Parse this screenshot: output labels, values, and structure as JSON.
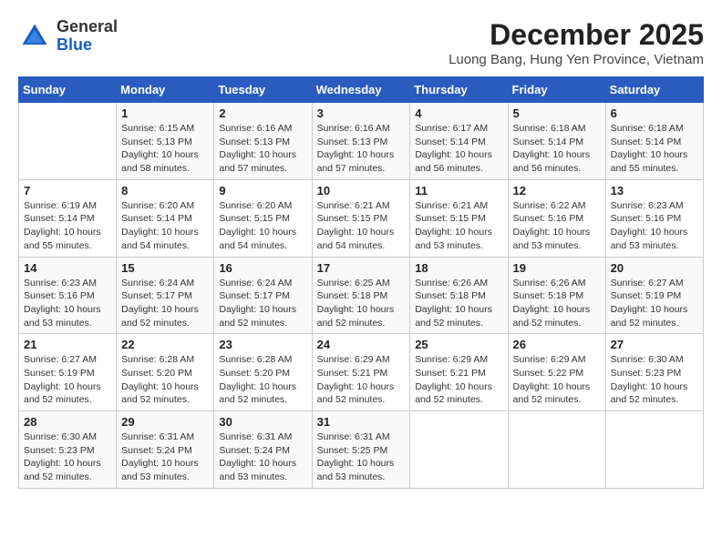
{
  "logo": {
    "general": "General",
    "blue": "Blue"
  },
  "title": {
    "month_year": "December 2025",
    "location": "Luong Bang, Hung Yen Province, Vietnam"
  },
  "calendar": {
    "days_of_week": [
      "Sunday",
      "Monday",
      "Tuesday",
      "Wednesday",
      "Thursday",
      "Friday",
      "Saturday"
    ],
    "weeks": [
      [
        {
          "day": "",
          "sunrise": "",
          "sunset": "",
          "daylight": ""
        },
        {
          "day": "1",
          "sunrise": "Sunrise: 6:15 AM",
          "sunset": "Sunset: 5:13 PM",
          "daylight": "Daylight: 10 hours and 58 minutes."
        },
        {
          "day": "2",
          "sunrise": "Sunrise: 6:16 AM",
          "sunset": "Sunset: 5:13 PM",
          "daylight": "Daylight: 10 hours and 57 minutes."
        },
        {
          "day": "3",
          "sunrise": "Sunrise: 6:16 AM",
          "sunset": "Sunset: 5:13 PM",
          "daylight": "Daylight: 10 hours and 57 minutes."
        },
        {
          "day": "4",
          "sunrise": "Sunrise: 6:17 AM",
          "sunset": "Sunset: 5:14 PM",
          "daylight": "Daylight: 10 hours and 56 minutes."
        },
        {
          "day": "5",
          "sunrise": "Sunrise: 6:18 AM",
          "sunset": "Sunset: 5:14 PM",
          "daylight": "Daylight: 10 hours and 56 minutes."
        },
        {
          "day": "6",
          "sunrise": "Sunrise: 6:18 AM",
          "sunset": "Sunset: 5:14 PM",
          "daylight": "Daylight: 10 hours and 55 minutes."
        }
      ],
      [
        {
          "day": "7",
          "sunrise": "Sunrise: 6:19 AM",
          "sunset": "Sunset: 5:14 PM",
          "daylight": "Daylight: 10 hours and 55 minutes."
        },
        {
          "day": "8",
          "sunrise": "Sunrise: 6:20 AM",
          "sunset": "Sunset: 5:14 PM",
          "daylight": "Daylight: 10 hours and 54 minutes."
        },
        {
          "day": "9",
          "sunrise": "Sunrise: 6:20 AM",
          "sunset": "Sunset: 5:15 PM",
          "daylight": "Daylight: 10 hours and 54 minutes."
        },
        {
          "day": "10",
          "sunrise": "Sunrise: 6:21 AM",
          "sunset": "Sunset: 5:15 PM",
          "daylight": "Daylight: 10 hours and 54 minutes."
        },
        {
          "day": "11",
          "sunrise": "Sunrise: 6:21 AM",
          "sunset": "Sunset: 5:15 PM",
          "daylight": "Daylight: 10 hours and 53 minutes."
        },
        {
          "day": "12",
          "sunrise": "Sunrise: 6:22 AM",
          "sunset": "Sunset: 5:16 PM",
          "daylight": "Daylight: 10 hours and 53 minutes."
        },
        {
          "day": "13",
          "sunrise": "Sunrise: 6:23 AM",
          "sunset": "Sunset: 5:16 PM",
          "daylight": "Daylight: 10 hours and 53 minutes."
        }
      ],
      [
        {
          "day": "14",
          "sunrise": "Sunrise: 6:23 AM",
          "sunset": "Sunset: 5:16 PM",
          "daylight": "Daylight: 10 hours and 53 minutes."
        },
        {
          "day": "15",
          "sunrise": "Sunrise: 6:24 AM",
          "sunset": "Sunset: 5:17 PM",
          "daylight": "Daylight: 10 hours and 52 minutes."
        },
        {
          "day": "16",
          "sunrise": "Sunrise: 6:24 AM",
          "sunset": "Sunset: 5:17 PM",
          "daylight": "Daylight: 10 hours and 52 minutes."
        },
        {
          "day": "17",
          "sunrise": "Sunrise: 6:25 AM",
          "sunset": "Sunset: 5:18 PM",
          "daylight": "Daylight: 10 hours and 52 minutes."
        },
        {
          "day": "18",
          "sunrise": "Sunrise: 6:26 AM",
          "sunset": "Sunset: 5:18 PM",
          "daylight": "Daylight: 10 hours and 52 minutes."
        },
        {
          "day": "19",
          "sunrise": "Sunrise: 6:26 AM",
          "sunset": "Sunset: 5:18 PM",
          "daylight": "Daylight: 10 hours and 52 minutes."
        },
        {
          "day": "20",
          "sunrise": "Sunrise: 6:27 AM",
          "sunset": "Sunset: 5:19 PM",
          "daylight": "Daylight: 10 hours and 52 minutes."
        }
      ],
      [
        {
          "day": "21",
          "sunrise": "Sunrise: 6:27 AM",
          "sunset": "Sunset: 5:19 PM",
          "daylight": "Daylight: 10 hours and 52 minutes."
        },
        {
          "day": "22",
          "sunrise": "Sunrise: 6:28 AM",
          "sunset": "Sunset: 5:20 PM",
          "daylight": "Daylight: 10 hours and 52 minutes."
        },
        {
          "day": "23",
          "sunrise": "Sunrise: 6:28 AM",
          "sunset": "Sunset: 5:20 PM",
          "daylight": "Daylight: 10 hours and 52 minutes."
        },
        {
          "day": "24",
          "sunrise": "Sunrise: 6:29 AM",
          "sunset": "Sunset: 5:21 PM",
          "daylight": "Daylight: 10 hours and 52 minutes."
        },
        {
          "day": "25",
          "sunrise": "Sunrise: 6:29 AM",
          "sunset": "Sunset: 5:21 PM",
          "daylight": "Daylight: 10 hours and 52 minutes."
        },
        {
          "day": "26",
          "sunrise": "Sunrise: 6:29 AM",
          "sunset": "Sunset: 5:22 PM",
          "daylight": "Daylight: 10 hours and 52 minutes."
        },
        {
          "day": "27",
          "sunrise": "Sunrise: 6:30 AM",
          "sunset": "Sunset: 5:23 PM",
          "daylight": "Daylight: 10 hours and 52 minutes."
        }
      ],
      [
        {
          "day": "28",
          "sunrise": "Sunrise: 6:30 AM",
          "sunset": "Sunset: 5:23 PM",
          "daylight": "Daylight: 10 hours and 52 minutes."
        },
        {
          "day": "29",
          "sunrise": "Sunrise: 6:31 AM",
          "sunset": "Sunset: 5:24 PM",
          "daylight": "Daylight: 10 hours and 53 minutes."
        },
        {
          "day": "30",
          "sunrise": "Sunrise: 6:31 AM",
          "sunset": "Sunset: 5:24 PM",
          "daylight": "Daylight: 10 hours and 53 minutes."
        },
        {
          "day": "31",
          "sunrise": "Sunrise: 6:31 AM",
          "sunset": "Sunset: 5:25 PM",
          "daylight": "Daylight: 10 hours and 53 minutes."
        },
        {
          "day": "",
          "sunrise": "",
          "sunset": "",
          "daylight": ""
        },
        {
          "day": "",
          "sunrise": "",
          "sunset": "",
          "daylight": ""
        },
        {
          "day": "",
          "sunrise": "",
          "sunset": "",
          "daylight": ""
        }
      ]
    ]
  }
}
